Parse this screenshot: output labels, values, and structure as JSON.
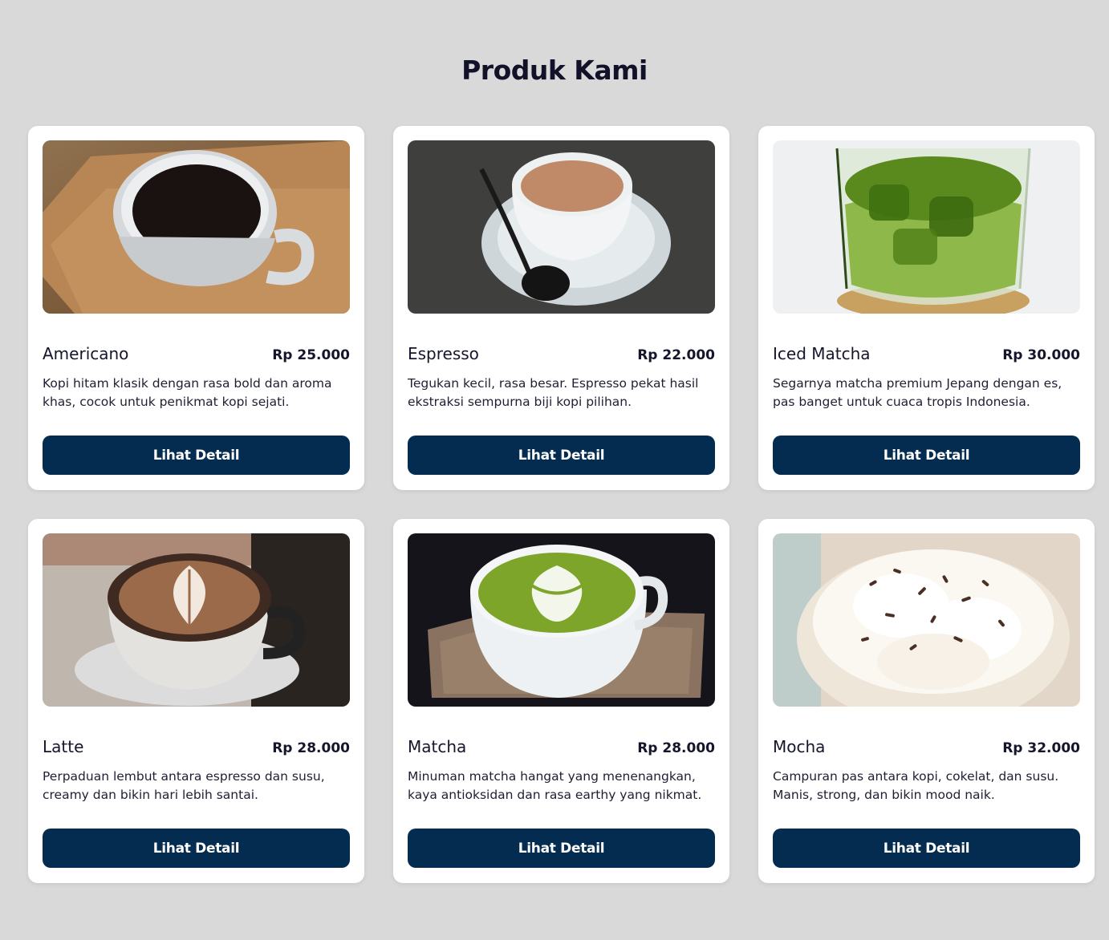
{
  "page": {
    "title": "Produk Kami"
  },
  "colors": {
    "background": "#d9d9d9",
    "card": "#ffffff",
    "button": "#032c50",
    "button_text": "#ffffff",
    "title": "#11112a"
  },
  "products": [
    {
      "name": "Americano",
      "price": "Rp 25.000",
      "description": "Kopi hitam klasik dengan rasa bold dan aroma khas, cocok untuk penikmat kopi sejati.",
      "button": "Lihat Detail",
      "image_icon": "americano-photo"
    },
    {
      "name": "Espresso",
      "price": "Rp 22.000",
      "description": "Tegukan kecil, rasa besar. Espresso pekat hasil ekstraksi sempurna biji kopi pilihan.",
      "button": "Lihat Detail",
      "image_icon": "espresso-photo"
    },
    {
      "name": "Iced Matcha",
      "price": "Rp 30.000",
      "description": "Segarnya matcha premium Jepang dengan es, pas banget untuk cuaca tropis Indonesia.",
      "button": "Lihat Detail",
      "image_icon": "iced-matcha-photo"
    },
    {
      "name": "Latte",
      "price": "Rp 28.000",
      "description": "Perpaduan lembut antara espresso dan susu, creamy dan bikin hari lebih santai.",
      "button": "Lihat Detail",
      "image_icon": "latte-photo"
    },
    {
      "name": "Matcha",
      "price": "Rp 28.000",
      "description": "Minuman matcha hangat yang menenangkan, kaya antioksidan dan rasa earthy yang nikmat.",
      "button": "Lihat Detail",
      "image_icon": "matcha-photo"
    },
    {
      "name": "Mocha",
      "price": "Rp 32.000",
      "description": "Campuran pas antara kopi, cokelat, dan susu. Manis, strong, dan bikin mood naik.",
      "button": "Lihat Detail",
      "image_icon": "mocha-photo"
    }
  ]
}
